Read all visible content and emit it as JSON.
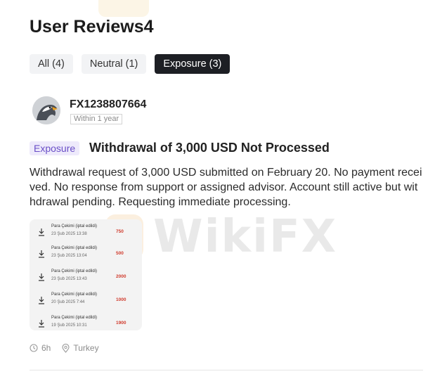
{
  "header": {
    "title": "User Reviews4"
  },
  "tabs": [
    {
      "label": "All (4)"
    },
    {
      "label": "Neutral (1)"
    },
    {
      "label": "Exposure (3)",
      "active": true
    }
  ],
  "review": {
    "username": "FX1238807664",
    "time_badge": "Within 1 year",
    "category": "Exposure",
    "title": "Withdrawal of 3,000 USD Not Processed",
    "body": "Withdrawal request of 3,000 USD submitted on February 20. No payment received. No response from support or assigned advisor. Account still active but withdrawal pending. Requesting immediate processing.",
    "attachment": {
      "rows": [
        {
          "title": "Para Çekimi (iptal edildi)",
          "date": "23 Şub 2025 13:38",
          "amount": "750"
        },
        {
          "title": "Para Çekimi (iptal edildi)",
          "date": "23 Şub 2025 13:04",
          "amount": "500"
        },
        {
          "title": "Para Çekimi (iptal edildi)",
          "date": "23 Şub 2025 13:43",
          "amount": "2000"
        },
        {
          "title": "Para Çekimi (iptal edildi)",
          "date": "20 Şub 2025 7:44",
          "amount": "1000"
        },
        {
          "title": "Para Çekimi (iptal edildi)",
          "date": "19 Şub 2025 10:31",
          "amount": "1900"
        }
      ]
    },
    "meta": {
      "age": "6h",
      "location": "Turkey"
    }
  },
  "watermark": {
    "text": "WikiFX"
  },
  "colors": {
    "tag_bg": "#eeeafb",
    "tag_text": "#6a4fc7",
    "amount": "#d03a2c",
    "active_tab": "#1d1f24"
  },
  "icons": {
    "meta_age": "clock-icon",
    "meta_location": "location-pin-icon",
    "tx": "withdraw-arrow-icon"
  }
}
